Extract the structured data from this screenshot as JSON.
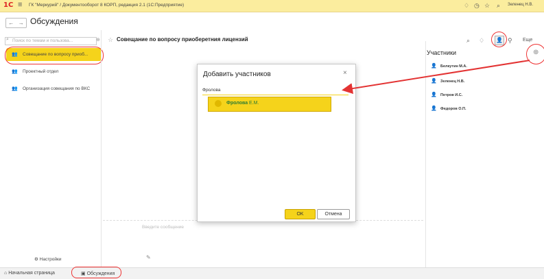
{
  "titlebar": {
    "logo": "1С",
    "menu_icon": "hamburger-icon",
    "title": "ГК \"Меркурий\" / Документооборот 8 КОРП, редакция 2.1  (1С:Предприятие)",
    "icons": [
      "bell-icon",
      "history-icon",
      "star-icon",
      "search-icon"
    ],
    "user": "Зеленец Н.В."
  },
  "nav": {
    "back": "←",
    "forward": "→"
  },
  "page_title": "Обсуждения",
  "sidebar": {
    "search_placeholder": "Поиск по темам и пользова...",
    "items": [
      {
        "label": "Совещание по вопросу приоб..."
      },
      {
        "label": "Проектный отдел"
      },
      {
        "label": "Организация совещания по ВКС"
      }
    ],
    "settings_label": "Настройки"
  },
  "topic": {
    "title": "Совещание по вопросу приоберетния лицензий",
    "more_label": "Еще",
    "message_placeholder": "Введите сообщение"
  },
  "participants": {
    "heading": "Участники",
    "list": [
      "Белкутин М.А.",
      "Зеленец Н.В.",
      "Петров И.С.",
      "Федоров О.П."
    ]
  },
  "dialog": {
    "title": "Добавить участников",
    "close": "×",
    "input_value": "Фролова",
    "suggestion_bold": "Фролова",
    "suggestion_rest": " Е.М.",
    "ok": "OK",
    "cancel": "Отмена"
  },
  "bottombar": {
    "home": "Начальная страница",
    "discussions": "Обсуждения"
  },
  "colors": {
    "accent": "#f5d31b",
    "titlebar": "#fbed9e",
    "annotation": "#e33333"
  }
}
